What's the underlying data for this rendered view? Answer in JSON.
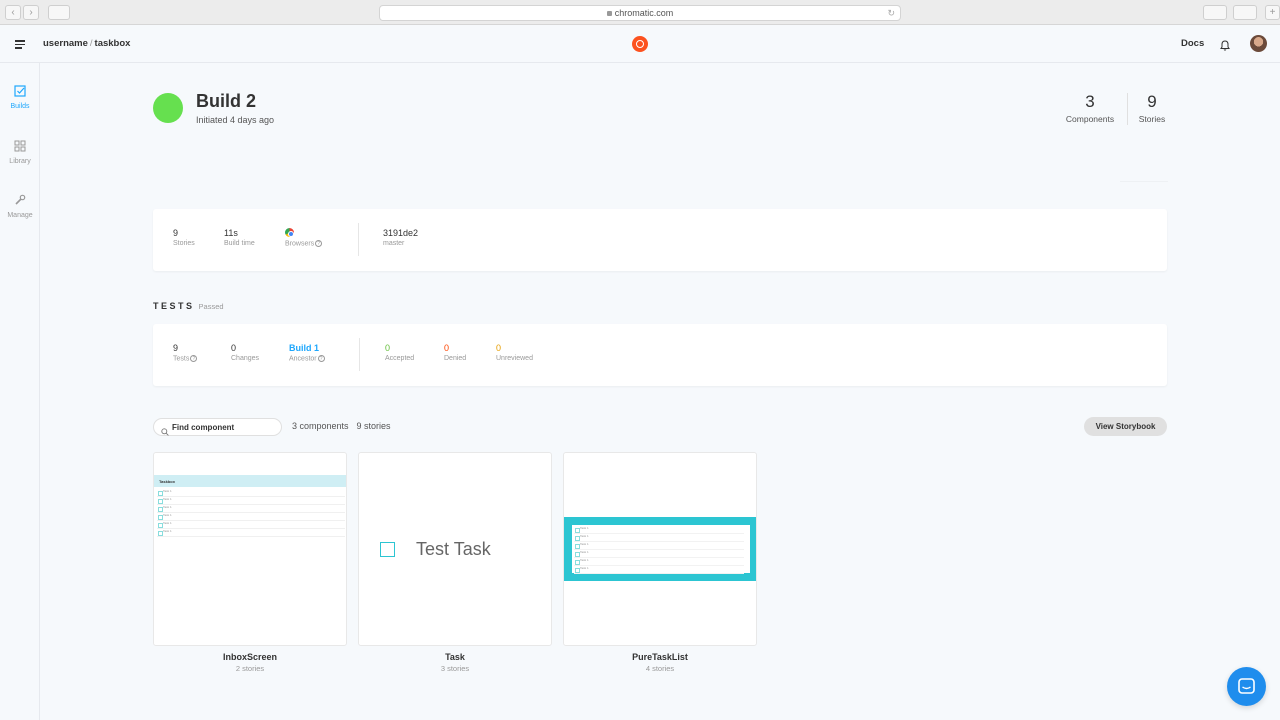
{
  "browser": {
    "url": "chromatic.com"
  },
  "header": {
    "owner": "username",
    "separator": "/",
    "project": "taskbox",
    "docs_label": "Docs"
  },
  "sidebar": {
    "items": [
      {
        "label": "Builds",
        "icon": "builds-icon",
        "active": true
      },
      {
        "label": "Library",
        "icon": "library-icon",
        "active": false
      },
      {
        "label": "Manage",
        "icon": "wrench-icon",
        "active": false
      }
    ]
  },
  "build": {
    "title": "Build 2",
    "subtitle": "Initiated 4 days ago",
    "status_color": "#66e04f",
    "components_count": "3",
    "components_label": "Components",
    "stories_count": "9",
    "stories_label": "Stories"
  },
  "summary": {
    "stories_value": "9",
    "stories_label": "Stories",
    "build_time_value": "11s",
    "build_time_label": "Build time",
    "browsers_label": "Browsers",
    "commit_value": "3191de2",
    "branch_label": "master"
  },
  "tests": {
    "heading": "TESTS",
    "status": "Passed",
    "tests_value": "9",
    "tests_label": "Tests",
    "changes_value": "0",
    "changes_label": "Changes",
    "ancestor_value": "Build 1",
    "ancestor_label": "Ancestor",
    "accepted_value": "0",
    "accepted_label": "Accepted",
    "denied_value": "0",
    "denied_label": "Denied",
    "unreviewed_value": "0",
    "unreviewed_label": "Unreviewed"
  },
  "library": {
    "search_placeholder": "Find component",
    "components_count_text": "3 components",
    "stories_count_text": "9 stories",
    "view_storybook_label": "View Storybook",
    "components": [
      {
        "name": "InboxScreen",
        "stories": "2 stories"
      },
      {
        "name": "Task",
        "stories": "3 stories"
      },
      {
        "name": "PureTaskList",
        "stories": "4 stories"
      }
    ]
  },
  "thumbs": {
    "inbox_header": "Taskbox",
    "row_label": "Task 1",
    "task_text": "Test Task"
  },
  "colors": {
    "accent": "#1ea7fd",
    "teal": "#2cc5d2",
    "accepted": "#66bf3c",
    "denied": "#ff4400",
    "unreviewed": "#e69d00"
  }
}
